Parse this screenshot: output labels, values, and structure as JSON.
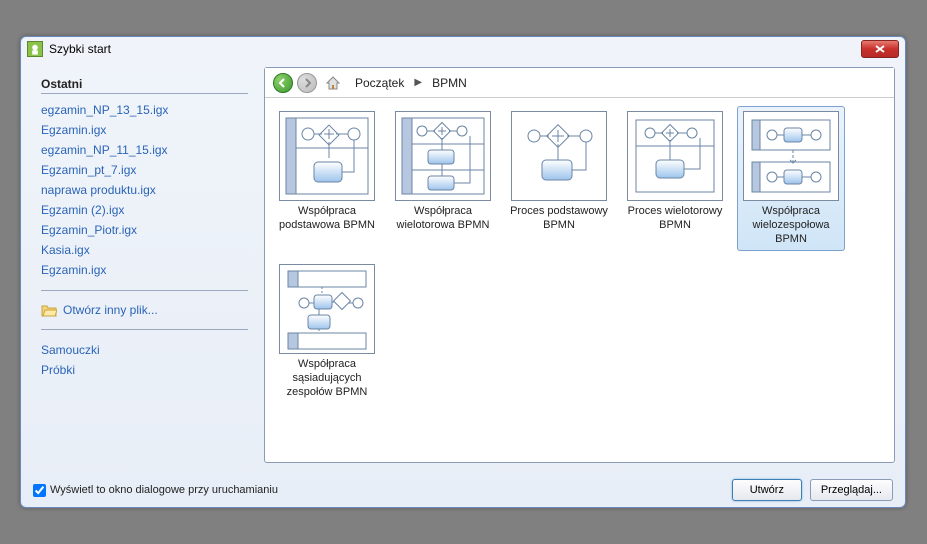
{
  "window": {
    "title": "Szybki start"
  },
  "sidebar": {
    "recent_heading": "Ostatni",
    "recent": [
      "egzamin_NP_13_15.igx",
      "Egzamin.igx",
      "egzamin_NP_11_15.igx",
      "Egzamin_pt_7.igx",
      "naprawa produktu.igx",
      "Egzamin (2).igx",
      "Egzamin_Piotr.igx",
      "Kasia.igx",
      "Egzamin.igx"
    ],
    "open_other": "Otwórz inny plik...",
    "links": [
      "Samouczki",
      "Próbki"
    ]
  },
  "breadcrumb": {
    "home": "Początek",
    "current": "BPMN"
  },
  "templates": [
    {
      "label": "Współpraca podstawowa BPMN",
      "icon": "pool-single",
      "selected": false
    },
    {
      "label": "Współpraca wielotorowa BPMN",
      "icon": "pool-multi",
      "selected": false
    },
    {
      "label": "Proces podstawowy BPMN",
      "icon": "process-basic",
      "selected": false
    },
    {
      "label": "Proces wielotorowy BPMN",
      "icon": "process-multi",
      "selected": false
    },
    {
      "label": "Współpraca wielozespołowa BPMN",
      "icon": "collab-multi",
      "selected": true
    },
    {
      "label": "Współpraca sąsiadujących zespołów BPMN",
      "icon": "collab-adj",
      "selected": false
    }
  ],
  "footer": {
    "checkbox_label": "Wyświetl to okno dialogowe przy uruchamianiu",
    "checkbox_checked": true,
    "create": "Utwórz",
    "browse": "Przeglądaj..."
  }
}
